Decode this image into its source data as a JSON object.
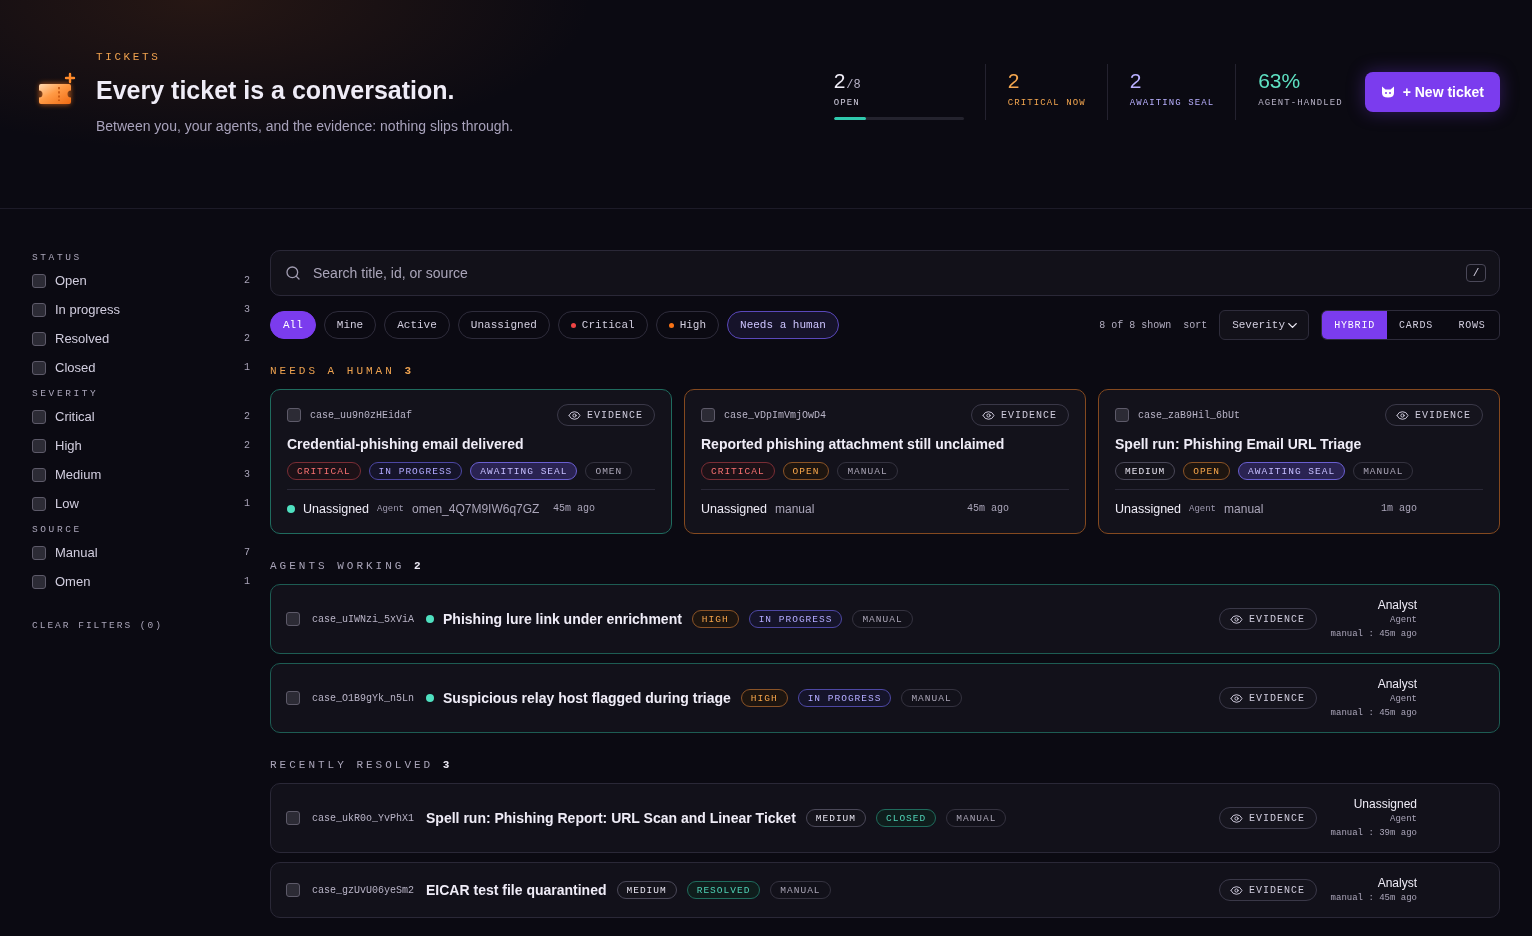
{
  "header": {
    "eyebrow": "TICKETS",
    "title": "Every ticket is a conversation.",
    "subtitle": "Between you, your agents, and the evidence: nothing slips through."
  },
  "stats": [
    {
      "value": "2",
      "suffix": "/8",
      "label": "OPEN",
      "kind": "plain",
      "level": 0.25
    },
    {
      "value": "2",
      "label": "CRITICAL NOW",
      "kind": "warning"
    },
    {
      "value": "2",
      "label": "AWAITING SEAL",
      "kind": "accent"
    },
    {
      "value": "63%",
      "label": "AGENT-HANDLED",
      "kind": "success"
    }
  ],
  "new_ticket_button": "+ New ticket",
  "sidebar": {
    "groups": [
      {
        "title": "STATUS",
        "items": [
          {
            "label": "Open",
            "count": "2",
            "checked": false
          },
          {
            "label": "In progress",
            "count": "3",
            "checked": false
          },
          {
            "label": "Resolved",
            "count": "2",
            "checked": false
          },
          {
            "label": "Closed",
            "count": "1",
            "checked": false
          }
        ]
      },
      {
        "title": "SEVERITY",
        "items": [
          {
            "label": "Critical",
            "count": "2",
            "checked": false
          },
          {
            "label": "High",
            "count": "2",
            "checked": false
          },
          {
            "label": "Medium",
            "count": "3",
            "checked": false
          },
          {
            "label": "Low",
            "count": "1",
            "checked": false
          }
        ]
      },
      {
        "title": "SOURCE",
        "items": [
          {
            "label": "Manual",
            "count": "7",
            "checked": false
          },
          {
            "label": "Omen",
            "count": "1",
            "checked": false
          }
        ]
      }
    ],
    "clear_filters": "CLEAR FILTERS (0)"
  },
  "search": {
    "placeholder": "Search title, id, or source",
    "shortcut": "/"
  },
  "filters": [
    {
      "label": "All",
      "kind": "plain",
      "selected": true
    },
    {
      "label": "Mine",
      "kind": "plain",
      "selected": false
    },
    {
      "label": "Active",
      "kind": "plain",
      "selected": false
    },
    {
      "label": "Unassigned",
      "kind": "plain",
      "selected": false
    },
    {
      "label": "Critical",
      "kind": "dot",
      "color": "#ef4444",
      "selected": false
    },
    {
      "label": "High",
      "kind": "dot",
      "color": "#f97316",
      "selected": false
    },
    {
      "label": "Needs a human",
      "kind": "accent",
      "selected": false
    }
  ],
  "results": "8 of 8 shown",
  "sort": {
    "label": "sort",
    "value": "Severity"
  },
  "view_modes": [
    {
      "label": "HYBRID",
      "selected": true
    },
    {
      "label": "CARDS",
      "selected": false
    },
    {
      "label": "ROWS",
      "selected": false
    }
  ],
  "sections": [
    {
      "title": "NEEDS A HUMAN",
      "count": "3",
      "highlight": true,
      "kind": "cards",
      "items": [
        {
          "id": "case_uu9n0zHEidaf",
          "checked": false,
          "evidence": "EVIDENCE",
          "title": "Credential-phishing email delivered",
          "tags": [
            {
              "label": "CRITICAL",
              "kind": "critical"
            },
            {
              "label": "IN PROGRESS",
              "kind": "progress"
            },
            {
              "label": "AWAITING SEAL",
              "kind": "seal"
            },
            {
              "label": "OMEN",
              "kind": "source"
            }
          ],
          "live": true,
          "assignee": "Unassigned",
          "agent_label": "Agent",
          "agent": "omen_4Q7M9IW6q7GZ",
          "time": "45m ago",
          "color": "#1f6b5e"
        },
        {
          "id": "case_vDpImVmjOwD4",
          "checked": false,
          "evidence": "EVIDENCE",
          "title": "Reported phishing attachment still unclaimed",
          "tags": [
            {
              "label": "CRITICAL",
              "kind": "critical"
            },
            {
              "label": "OPEN",
              "kind": "open"
            },
            {
              "label": "MANUAL",
              "kind": "source"
            }
          ],
          "live": false,
          "assignee": "Unassigned",
          "agent": "manual",
          "time": "45m ago",
          "color": "#84491f"
        },
        {
          "id": "case_zaB9Hil_6bUt",
          "checked": false,
          "evidence": "EVIDENCE",
          "title": "Spell run: Phishing Email URL Triage",
          "tags": [
            {
              "label": "MEDIUM",
              "kind": "medium"
            },
            {
              "label": "OPEN",
              "kind": "open"
            },
            {
              "label": "AWAITING SEAL",
              "kind": "seal"
            },
            {
              "label": "MANUAL",
              "kind": "source"
            }
          ],
          "live": false,
          "assignee": "Unassigned",
          "agent_label": "Agent",
          "agent": "manual",
          "time": "1m ago",
          "color": "#84491f"
        }
      ]
    },
    {
      "title": "AGENTS WORKING",
      "count": "2",
      "highlight": false,
      "kind": "rows",
      "items": [
        {
          "id": "case_uIWNzi_5xViA",
          "checked": false,
          "live": true,
          "title": "Phishing lure link under enrichment",
          "tags": [
            {
              "label": "HIGH",
              "kind": "high"
            },
            {
              "label": "IN PROGRESS",
              "kind": "progress"
            },
            {
              "label": "MANUAL",
              "kind": "source"
            }
          ],
          "evidence": "EVIDENCE",
          "assignee": "Analyst",
          "agent_label": "Agent",
          "meta": "manual : 45m ago",
          "color": "#1d5c53"
        },
        {
          "id": "case_O1B9gYk_n5Ln",
          "checked": false,
          "live": true,
          "title": "Suspicious relay host flagged during triage",
          "tags": [
            {
              "label": "HIGH",
              "kind": "high"
            },
            {
              "label": "IN PROGRESS",
              "kind": "progress"
            },
            {
              "label": "MANUAL",
              "kind": "source"
            }
          ],
          "evidence": "EVIDENCE",
          "assignee": "Analyst",
          "agent_label": "Agent",
          "meta": "manual : 45m ago",
          "color": "#1d5c53"
        }
      ]
    },
    {
      "title": "RECENTLY RESOLVED",
      "count": "3",
      "highlight": false,
      "kind": "rows",
      "items": [
        {
          "id": "case_ukR0o_YvPhX1",
          "checked": false,
          "live": false,
          "title": "Spell run: Phishing Report: URL Scan and Linear Ticket",
          "tags": [
            {
              "label": "MEDIUM",
              "kind": "medium"
            },
            {
              "label": "CLOSED",
              "kind": "done"
            },
            {
              "label": "MANUAL",
              "kind": "source"
            }
          ],
          "evidence": "EVIDENCE",
          "assignee": "Unassigned",
          "agent_label": "Agent",
          "meta": "manual : 39m ago",
          "color": "#2a2837"
        },
        {
          "id": "case_gzUvU06yeSm2",
          "checked": false,
          "live": false,
          "title": "EICAR test file quarantined",
          "tags": [
            {
              "label": "MEDIUM",
              "kind": "medium"
            },
            {
              "label": "RESOLVED",
              "kind": "done"
            },
            {
              "label": "MANUAL",
              "kind": "source"
            }
          ],
          "evidence": "EVIDENCE",
          "assignee": "Analyst",
          "meta": "manual : 45m ago",
          "color": "#2a2837"
        }
      ]
    }
  ]
}
